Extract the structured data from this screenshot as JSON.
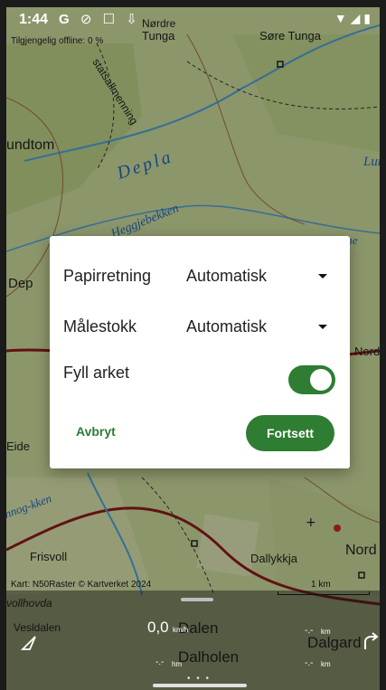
{
  "status": {
    "time": "1:44",
    "icons": [
      "G",
      "no-disturb",
      "screen",
      "download"
    ]
  },
  "map": {
    "offline_text": "Tilgjengelig offline: 0 %",
    "credit": "Kart: N50Raster © Kartverket 2024",
    "scale": "1 km",
    "labels": [
      "Nørdre",
      "Tunga",
      "Søre Tunga",
      "statsallmenning",
      "undtom",
      "Depla",
      "Lur",
      "Heggjebekken",
      "Furutjonne",
      "Dep",
      "Nord",
      "Eide",
      "nnog-kken",
      "Frisvoll",
      "Dallykkja",
      "Nord",
      "vollhovda",
      "Vesldalen",
      "Dalen",
      "Dalholen",
      "Dalgard"
    ]
  },
  "dialog": {
    "paper_label": "Papirretning",
    "paper_value": "Automatisk",
    "scale_label": "Målestokk",
    "scale_value": "Automatisk",
    "fill_label": "Fyll arket",
    "fill_on": true,
    "cancel_label": "Avbryt",
    "continue_label": "Fortsett"
  },
  "panel": {
    "speed": "0,0",
    "speed_unit": "km/h",
    "hm_value": "-.-",
    "hm_unit": "hm",
    "km_value_1": "-.-",
    "km_unit_1": "km",
    "km_value_2": "-.-",
    "km_unit_2": "km"
  },
  "colors": {
    "accent": "#2e7d32"
  }
}
